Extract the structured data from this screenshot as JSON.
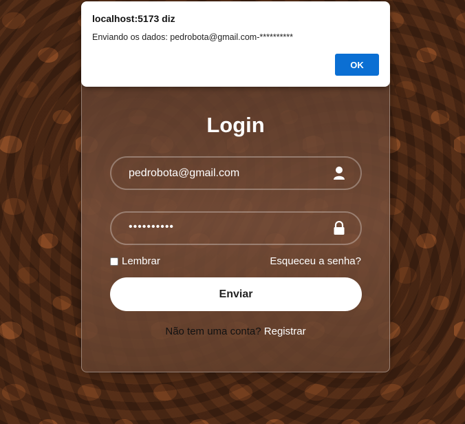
{
  "dialog": {
    "title": "localhost:5173 diz",
    "message": "Enviando os dados: pedrobota@gmail.com-**********",
    "ok_label": "OK"
  },
  "login": {
    "title": "Login",
    "email_value": "pedrobota@gmail.com",
    "password_value": "••••••••••",
    "remember_label": "Lembrar",
    "forgot_label": "Esqueceu a senha?",
    "submit_label": "Enviar",
    "signup_question": "Não tem uma conta?",
    "signup_link": "Registrar"
  },
  "icons": {
    "email": "user-icon",
    "password": "lock-icon"
  },
  "colors": {
    "ok_button": "#0b6fd3",
    "card_bg": "#6e4a35",
    "submit_bg": "#ffffff"
  }
}
